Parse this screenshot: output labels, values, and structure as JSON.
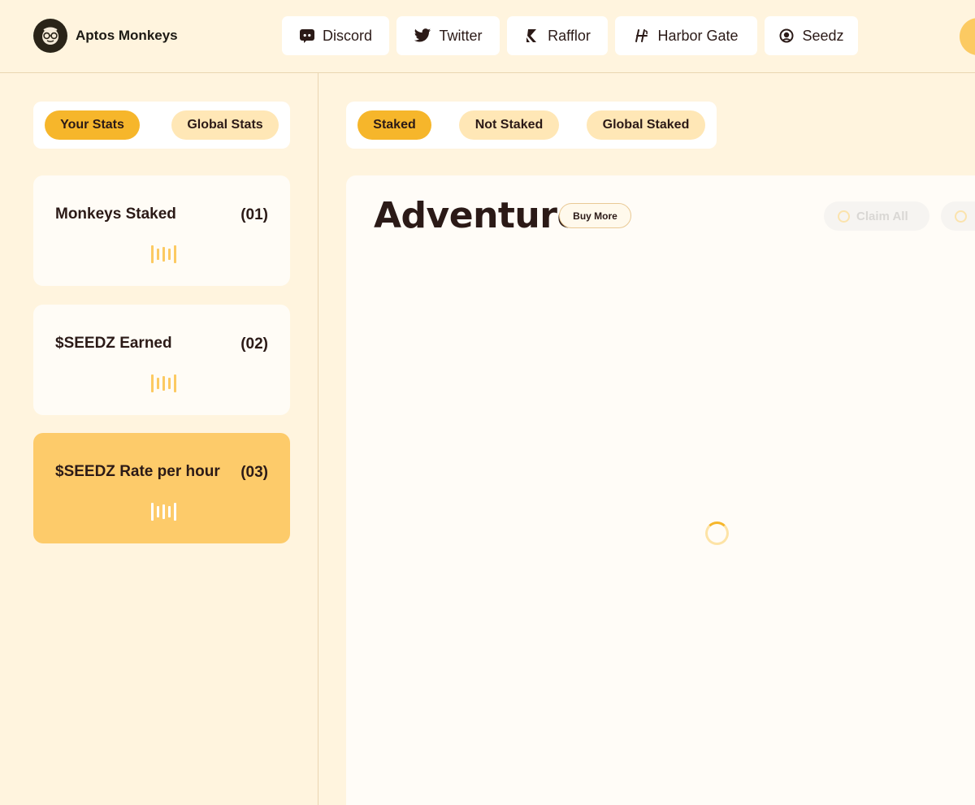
{
  "brand": {
    "name": "Aptos Monkeys",
    "logo_icon": "monkey-logo-icon"
  },
  "nav": {
    "links": [
      {
        "label": "Discord",
        "icon": "discord-icon"
      },
      {
        "label": "Twitter",
        "icon": "twitter-icon"
      },
      {
        "label": "Rafflor",
        "icon": "rafflor-icon"
      },
      {
        "label": "Harbor Gate",
        "icon": "harbor-gate-icon"
      },
      {
        "label": "Seedz",
        "icon": "seedz-icon"
      }
    ]
  },
  "stats_tabs": {
    "your_stats": "Your Stats",
    "global_stats": "Global Stats",
    "active": "Your Stats"
  },
  "staking_tabs": {
    "staked": "Staked",
    "not_staked": "Not Staked",
    "global_staked": "Global Staked",
    "active": "Staked"
  },
  "stats": [
    {
      "label": "Monkeys Staked",
      "index": "(01)"
    },
    {
      "label": "$SEEDZ Earned",
      "index": "(02)"
    },
    {
      "label": "$SEEDZ Rate per hour",
      "index": "(03)"
    }
  ],
  "main": {
    "title": "Adventure",
    "buy_more": "Buy More",
    "claim_all": "Claim All"
  },
  "colors": {
    "background": "#fff4de",
    "accent": "#f6b62b",
    "accent_light": "#ffe7b6",
    "highlight_card": "#fdcb6a",
    "text": "#2b1a17"
  }
}
